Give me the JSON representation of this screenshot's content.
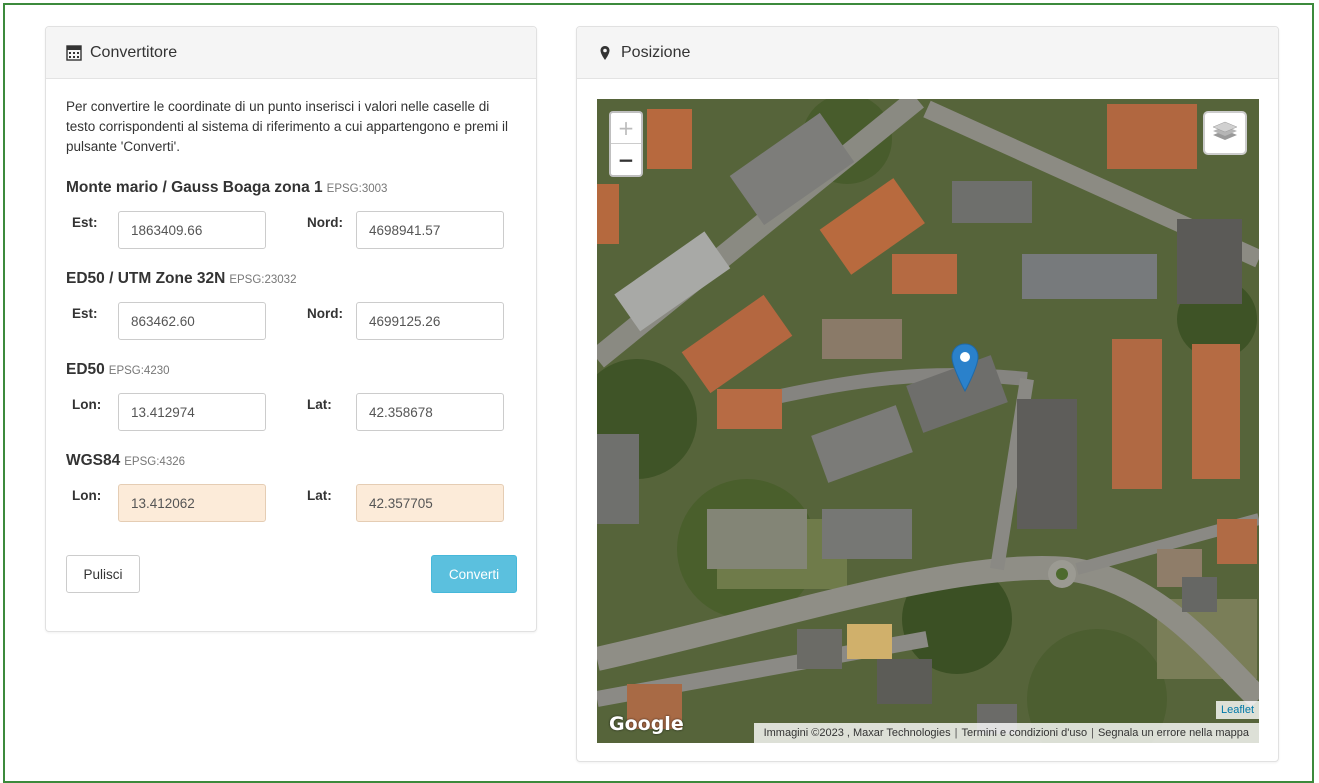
{
  "converter": {
    "title": "Convertitore",
    "intro": "Per convertire le coordinate di un punto inserisci i valori nelle caselle di testo corrispondenti al sistema di riferimento a cui appartengono e premi il pulsante 'Converti'.",
    "systems": [
      {
        "name": "Monte mario / Gauss Boaga zona 1",
        "epsg": "EPSG:3003",
        "label_a": "Est:",
        "value_a": "1863409.66",
        "label_b": "Nord:",
        "value_b": "4698941.57"
      },
      {
        "name": "ED50 / UTM Zone 32N",
        "epsg": "EPSG:23032",
        "label_a": "Est:",
        "value_a": "863462.60",
        "label_b": "Nord:",
        "value_b": "4699125.26"
      },
      {
        "name": "ED50",
        "epsg": "EPSG:4230",
        "label_a": "Lon:",
        "value_a": "13.412974",
        "label_b": "Lat:",
        "value_b": "42.358678"
      },
      {
        "name": "WGS84",
        "epsg": "EPSG:4326",
        "label_a": "Lon:",
        "value_a": "13.412062",
        "label_b": "Lat:",
        "value_b": "42.357705"
      }
    ],
    "clear_label": "Pulisci",
    "convert_label": "Converti",
    "highlight_color": "#fcebd9",
    "convert_color": "#5bc0de"
  },
  "position": {
    "title": "Posizione",
    "zoom_in": "+",
    "zoom_out": "−",
    "google_logo": "Google",
    "leaflet_link": "Leaflet",
    "attribution": [
      "Immagini ©2023 , Maxar Technologies",
      "Termini e condizioni d'uso",
      "Segnala un errore nella mappa"
    ],
    "marker_color": "#2a81cb"
  },
  "icons": {
    "converter": "calculator-icon",
    "position": "map-marker-icon",
    "layers": "layers-icon",
    "marker": "map-pin-icon"
  }
}
